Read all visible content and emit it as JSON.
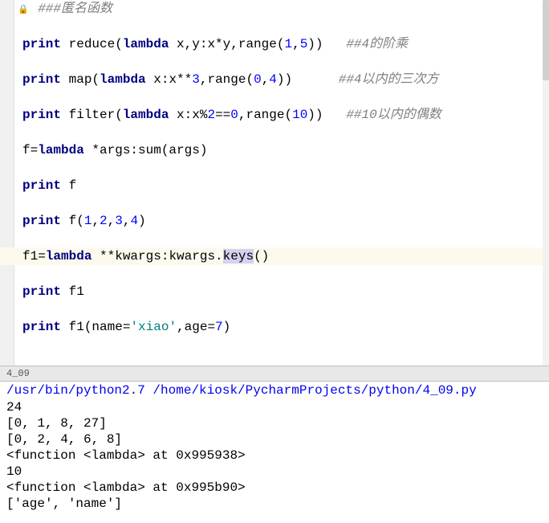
{
  "code": {
    "line1": "###匿名函数",
    "line3a": "print",
    "line3b": " reduce(",
    "line3c": "lambda",
    "line3d": " x,y:x*y,range(",
    "line3e": "1",
    "line3f": ",",
    "line3g": "5",
    "line3h": "))   ",
    "line3i": "##4的阶乘",
    "line5a": "print",
    "line5b": " map(",
    "line5c": "lambda",
    "line5d": " x:x**",
    "line5e": "3",
    "line5f": ",range(",
    "line5g": "0",
    "line5h": ",",
    "line5i": "4",
    "line5j": "))      ",
    "line5k": "##4以内的三次方",
    "line7a": "print",
    "line7b": " filter(",
    "line7c": "lambda",
    "line7d": " x:x%",
    "line7e": "2",
    "line7f": "==",
    "line7g": "0",
    "line7h": ",range(",
    "line7i": "10",
    "line7j": "))   ",
    "line7k": "##10以内的偶数",
    "line9a": "f=",
    "line9b": "lambda",
    "line9c": " *args:sum(args)",
    "line11a": "print",
    "line11b": " f",
    "line13a": "print",
    "line13b": " f(",
    "line13c": "1",
    "line13d": ",",
    "line13e": "2",
    "line13f": ",",
    "line13g": "3",
    "line13h": ",",
    "line13i": "4",
    "line13j": ")",
    "line15a": "f1=",
    "line15b": "lambda",
    "line15c": " **kwargs:kwargs.",
    "line15d": "keys",
    "line15e": "()",
    "line17a": "print",
    "line17b": " f1",
    "line19a": "print",
    "line19b": " f1(name=",
    "line19c": "'xiao'",
    "line19d": ",age=",
    "line19e": "7",
    "line19f": ")"
  },
  "console": {
    "tab": "4_09",
    "cmd": "/usr/bin/python2.7 /home/kiosk/PycharmProjects/python/4_09.py",
    "out1": "24",
    "out2": "[0, 1, 8, 27]",
    "out3": "[0, 2, 4, 6, 8]",
    "out4": "<function <lambda> at 0x995938>",
    "out5": "10",
    "out6": "<function <lambda> at 0x995b90>",
    "out7": "['age', 'name']"
  }
}
